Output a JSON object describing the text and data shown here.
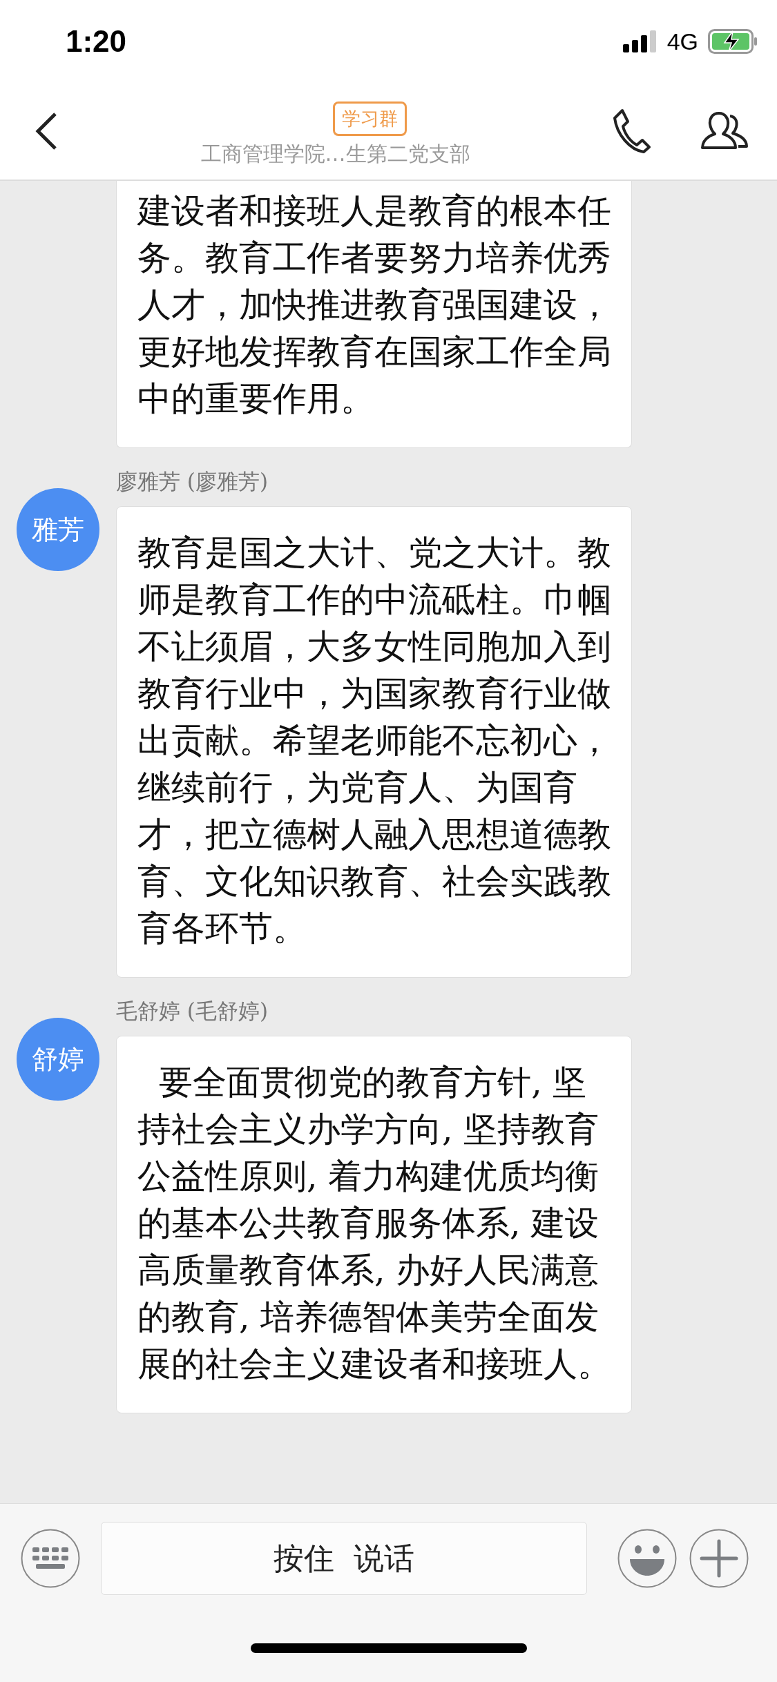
{
  "status_bar": {
    "time": "1:20",
    "network": "4G"
  },
  "header": {
    "tag": "学习群",
    "title": "工商管理学院…生第二党支部"
  },
  "messages": [
    {
      "kind": "continued",
      "text": "建设者和接班人是教育的根本任务。教育工作者要努力培养优秀人才，加快推进教育强国建设，更好地发挥教育在国家工作全局中的重要作用。"
    },
    {
      "kind": "full",
      "sender": "廖雅芳 (廖雅芳)",
      "avatar": "雅芳",
      "text": "教育是国之大计、党之大计。教师是教育工作的中流砥柱。巾帼不让须眉，大多女性同胞加入到教育行业中，为国家教育行业做出贡献。希望老师能不忘初心，继续前行，为党育人、为国育才，把立德树人融入思想道德教育、文化知识教育、社会实践教育各环节。"
    },
    {
      "kind": "full",
      "sender": "毛舒婷 (毛舒婷)",
      "avatar": "舒婷",
      "text": "  要全面贯彻党的教育方针, 坚持社会主义办学方向, 坚持教育公益性原则, 着力构建优质均衡的基本公共教育服务体系, 建设高质量教育体系, 办好人民满意的教育, 培养德智体美劳全面发展的社会主义建设者和接班人。"
    }
  ],
  "input": {
    "hold_to_talk": "按住  说话"
  }
}
